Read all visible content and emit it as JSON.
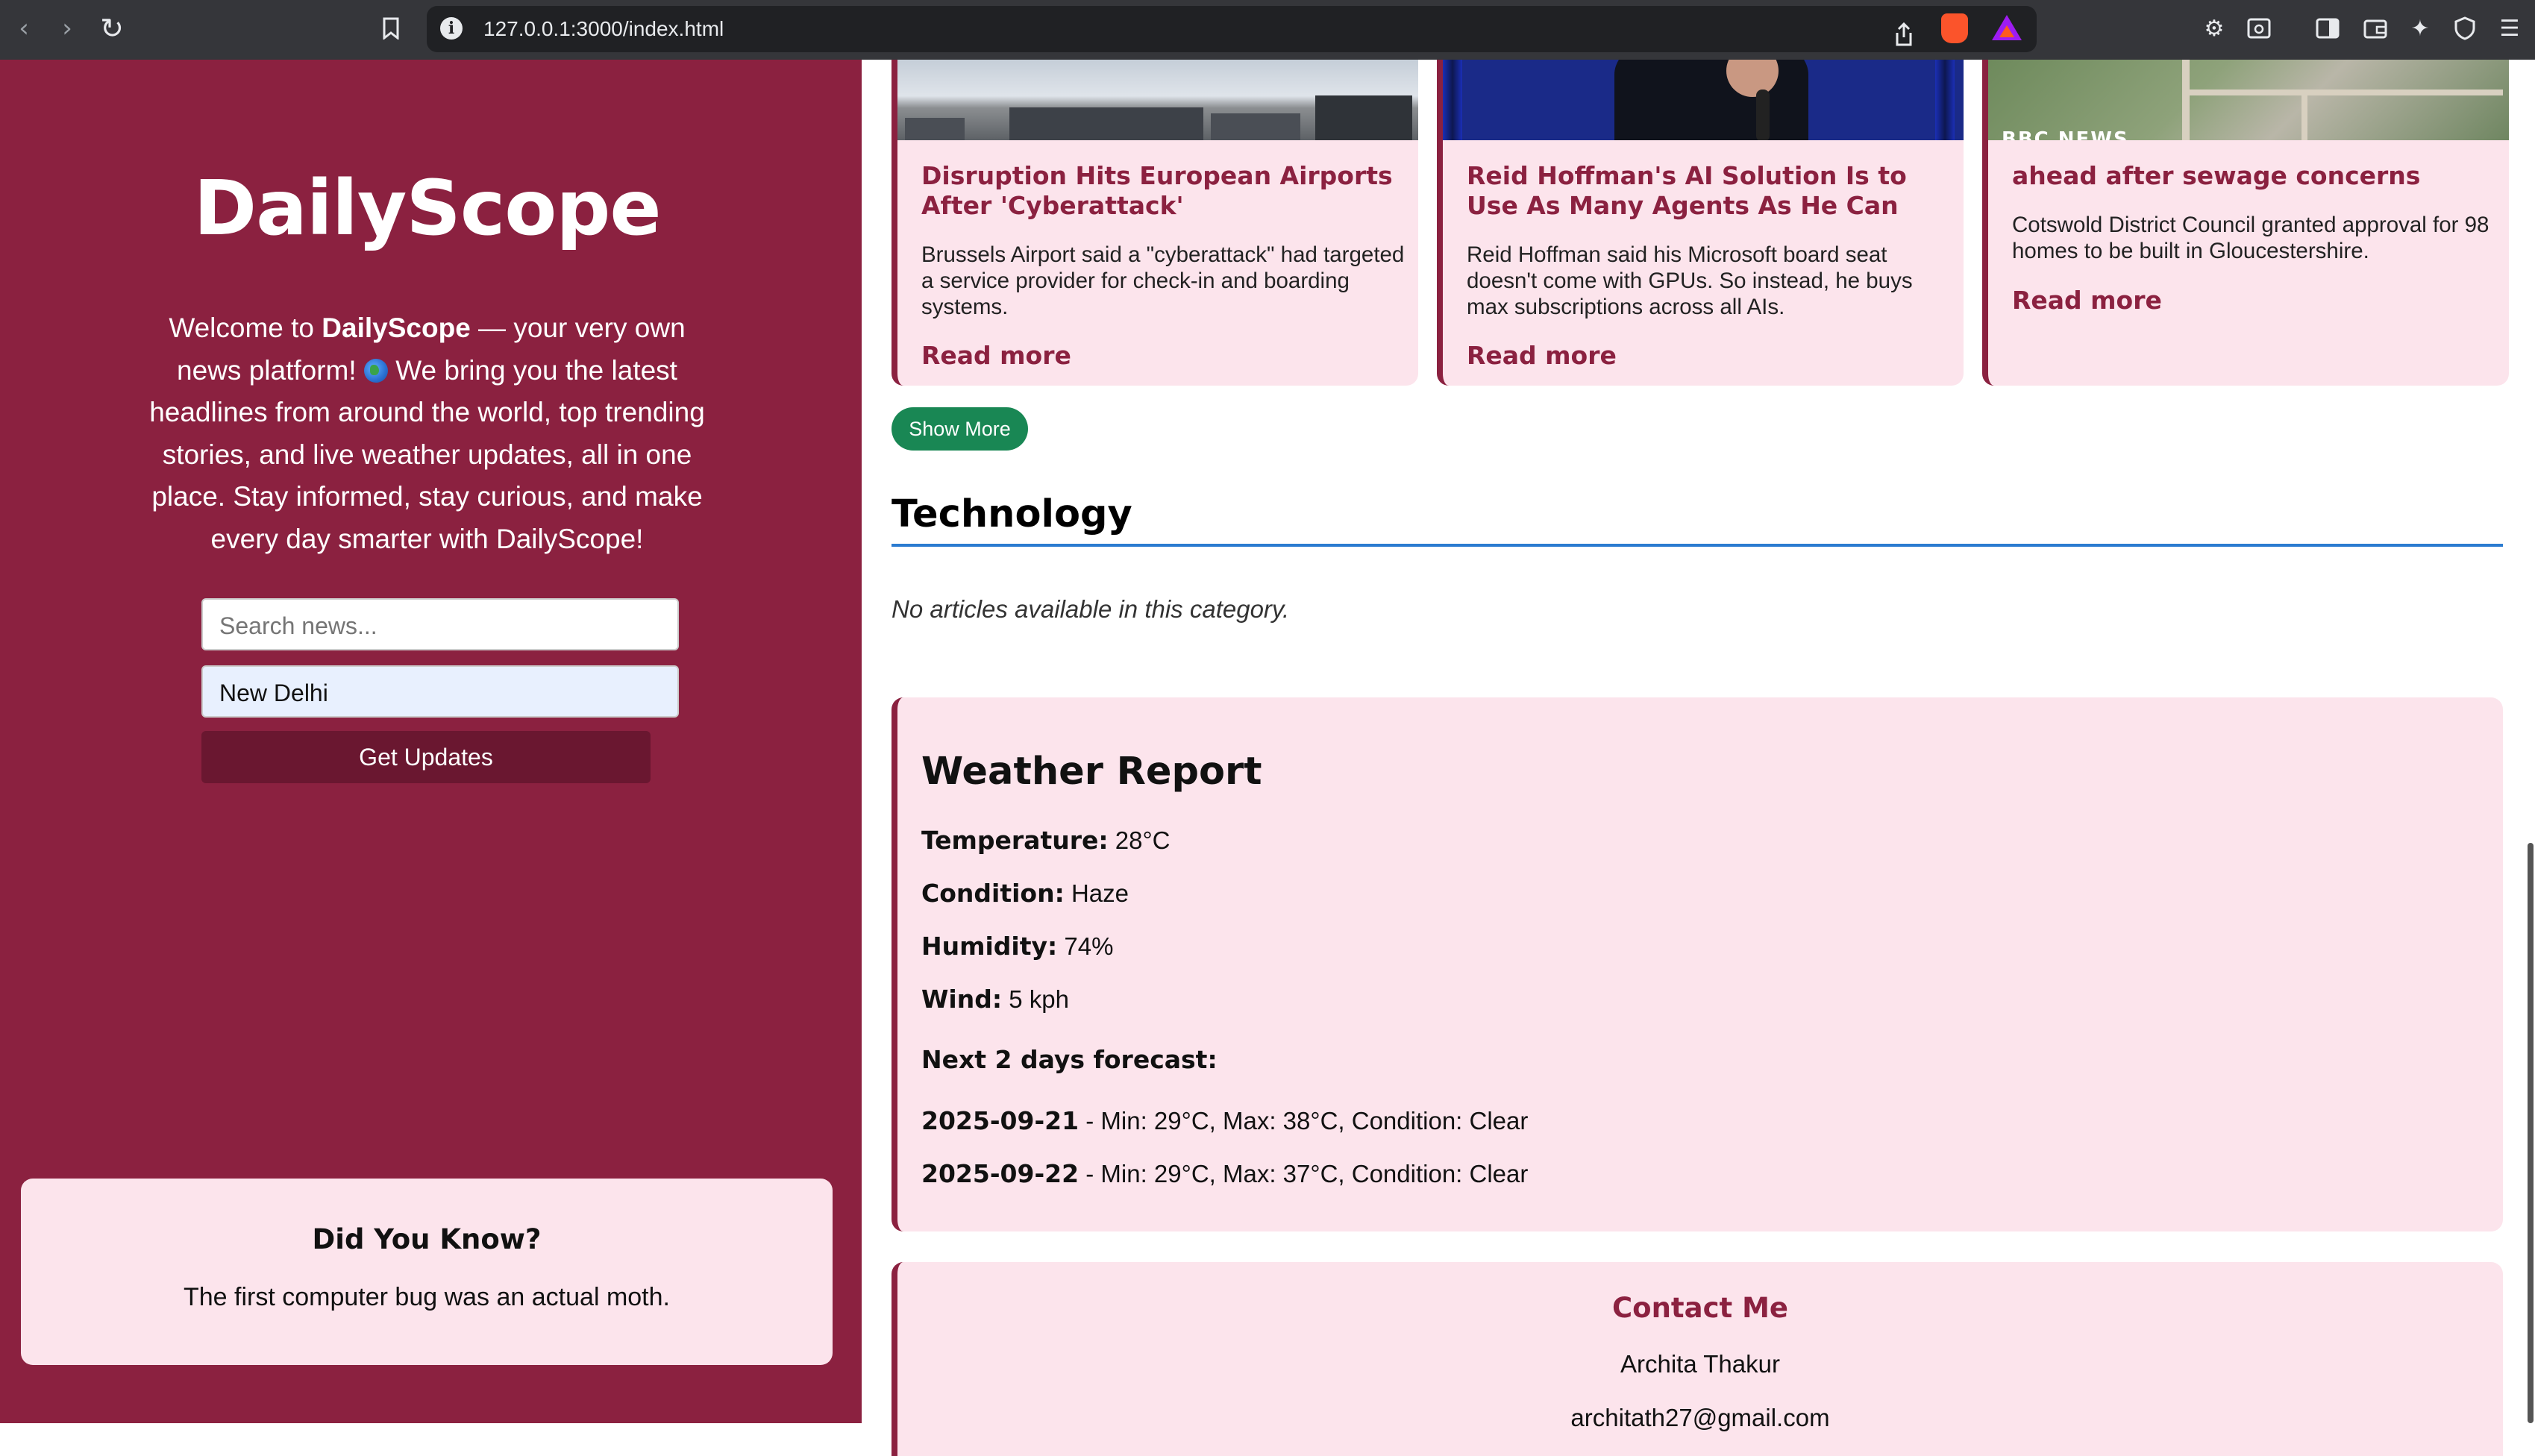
{
  "browser": {
    "url": "127.0.0.1:3000/index.html",
    "icons": [
      "back-icon",
      "forward-icon",
      "reload-icon",
      "bookmark-icon",
      "site-info-icon",
      "share-icon",
      "brave-shields-icon",
      "brave-rewards-icon",
      "extensions-icon",
      "tab-search-icon",
      "sidebar-icon",
      "wallet-icon",
      "leo-ai-icon",
      "vpn-icon",
      "menu-icon"
    ]
  },
  "sidebar": {
    "title": "DailyScope",
    "intro_before": "Welcome to ",
    "intro_brand": "DailyScope",
    "intro_after_brand": " — your very own news platform! ",
    "intro_rest": " We bring you the latest headlines from around the world, top trending stories, and live weather updates, all in one place. Stay informed, stay curious, and make every day smarter with DailyScope!",
    "search_placeholder": "Search news...",
    "city_value": "New Delhi",
    "button_label": "Get Updates",
    "did_you_know": {
      "title": "Did You Know?",
      "fact": "The first computer bug was an actual moth."
    }
  },
  "articles": [
    {
      "title": "Disruption Hits European Airports After 'Cyberattack'",
      "description": "Brussels Airport said a \"cyberattack\" had targeted a service provider for check-in and boarding systems.",
      "link": "Read more"
    },
    {
      "title": "Reid Hoffman's AI Solution Is to Use As Many Agents As He Can",
      "description": "Reid Hoffman said his Microsoft board seat doesn't come with GPUs. So instead, he buys max subscriptions across all AIs.",
      "link": "Read more"
    },
    {
      "title": "ahead after sewage concerns",
      "description": "Cotswold District Council granted approval for 98 homes to be built in Gloucestershire.",
      "link": "Read more",
      "image_caption": "BBC NEWS"
    }
  ],
  "show_more_label": "Show More",
  "technology": {
    "heading": "Technology",
    "empty_message": "No articles available in this category."
  },
  "weather": {
    "title": "Weather Report",
    "temperature_label": "Temperature:",
    "temperature": "28°C",
    "condition_label": "Condition:",
    "condition": "Haze",
    "humidity_label": "Humidity:",
    "humidity": "74%",
    "wind_label": "Wind:",
    "wind": "5 kph",
    "forecast_label": "Next 2 days forecast:",
    "forecast": [
      {
        "date": "2025-09-21",
        "details": " - Min: 29°C, Max: 38°C, Condition: Clear"
      },
      {
        "date": "2025-09-22",
        "details": " - Min: 29°C, Max: 37°C, Condition: Clear"
      }
    ]
  },
  "contact": {
    "title": "Contact Me",
    "name": "Archita Thakur",
    "email": "architath27@gmail.com"
  },
  "colors": {
    "brand": "#8b2140",
    "card_bg": "#fce4ec",
    "button_dark": "#6a1730",
    "show_more": "#198754",
    "rule": "#2b7bd0"
  }
}
